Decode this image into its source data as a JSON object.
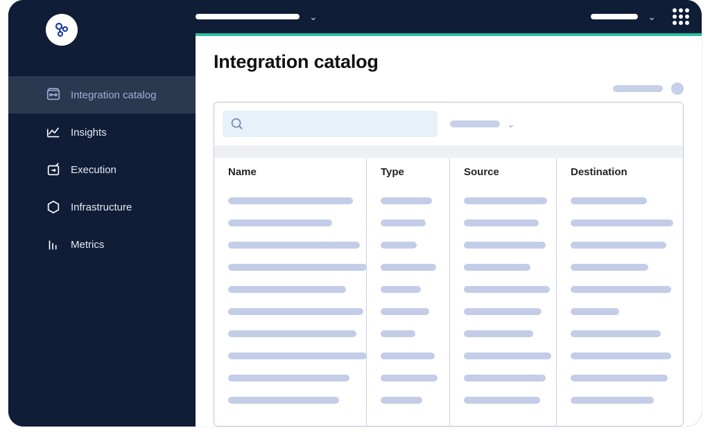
{
  "colors": {
    "accent_teal": "#2abfa3",
    "navy": "#0f1d36",
    "sidebar_active": "#2a3850",
    "placeholder": "#c3cde8"
  },
  "sidebar": {
    "items": [
      {
        "label": "Integration catalog",
        "icon": "integration-catalog-icon",
        "active": true
      },
      {
        "label": "Insights",
        "icon": "insights-icon",
        "active": false
      },
      {
        "label": "Execution",
        "icon": "execution-icon",
        "active": false
      },
      {
        "label": "Infrastructure",
        "icon": "infrastructure-icon",
        "active": false
      },
      {
        "label": "Metrics",
        "icon": "metrics-icon",
        "active": false
      }
    ]
  },
  "page": {
    "title": "Integration catalog"
  },
  "table": {
    "columns": [
      {
        "key": "name",
        "header": "Name"
      },
      {
        "key": "type",
        "header": "Type"
      },
      {
        "key": "source",
        "header": "Source"
      },
      {
        "key": "destination",
        "header": "Destination"
      }
    ],
    "rows": [
      {
        "name_w": 180,
        "type_w": 74,
        "source_w": 120,
        "dest_w": 110,
        "dest2_w": 0
      },
      {
        "name_w": 150,
        "type_w": 65,
        "source_w": 108,
        "dest_w": 148,
        "dest2_w": 0
      },
      {
        "name_w": 190,
        "type_w": 52,
        "source_w": 118,
        "dest_w": 138,
        "dest2_w": 0
      },
      {
        "name_w": 200,
        "type_w": 80,
        "source_w": 96,
        "dest_w": 112,
        "dest2_w": 0
      },
      {
        "name_w": 170,
        "type_w": 58,
        "source_w": 124,
        "dest_w": 145,
        "dest2_w": 0
      },
      {
        "name_w": 195,
        "type_w": 70,
        "source_w": 112,
        "dest_w": 70,
        "dest2_w": 0
      },
      {
        "name_w": 185,
        "type_w": 50,
        "source_w": 100,
        "dest_w": 130,
        "dest2_w": 0
      },
      {
        "name_w": 200,
        "type_w": 78,
        "source_w": 126,
        "dest_w": 145,
        "dest2_w": 0
      },
      {
        "name_w": 175,
        "type_w": 82,
        "source_w": 118,
        "dest_w": 140,
        "dest2_w": 0
      },
      {
        "name_w": 160,
        "type_w": 60,
        "source_w": 110,
        "dest_w": 120,
        "dest2_w": 0
      }
    ]
  }
}
